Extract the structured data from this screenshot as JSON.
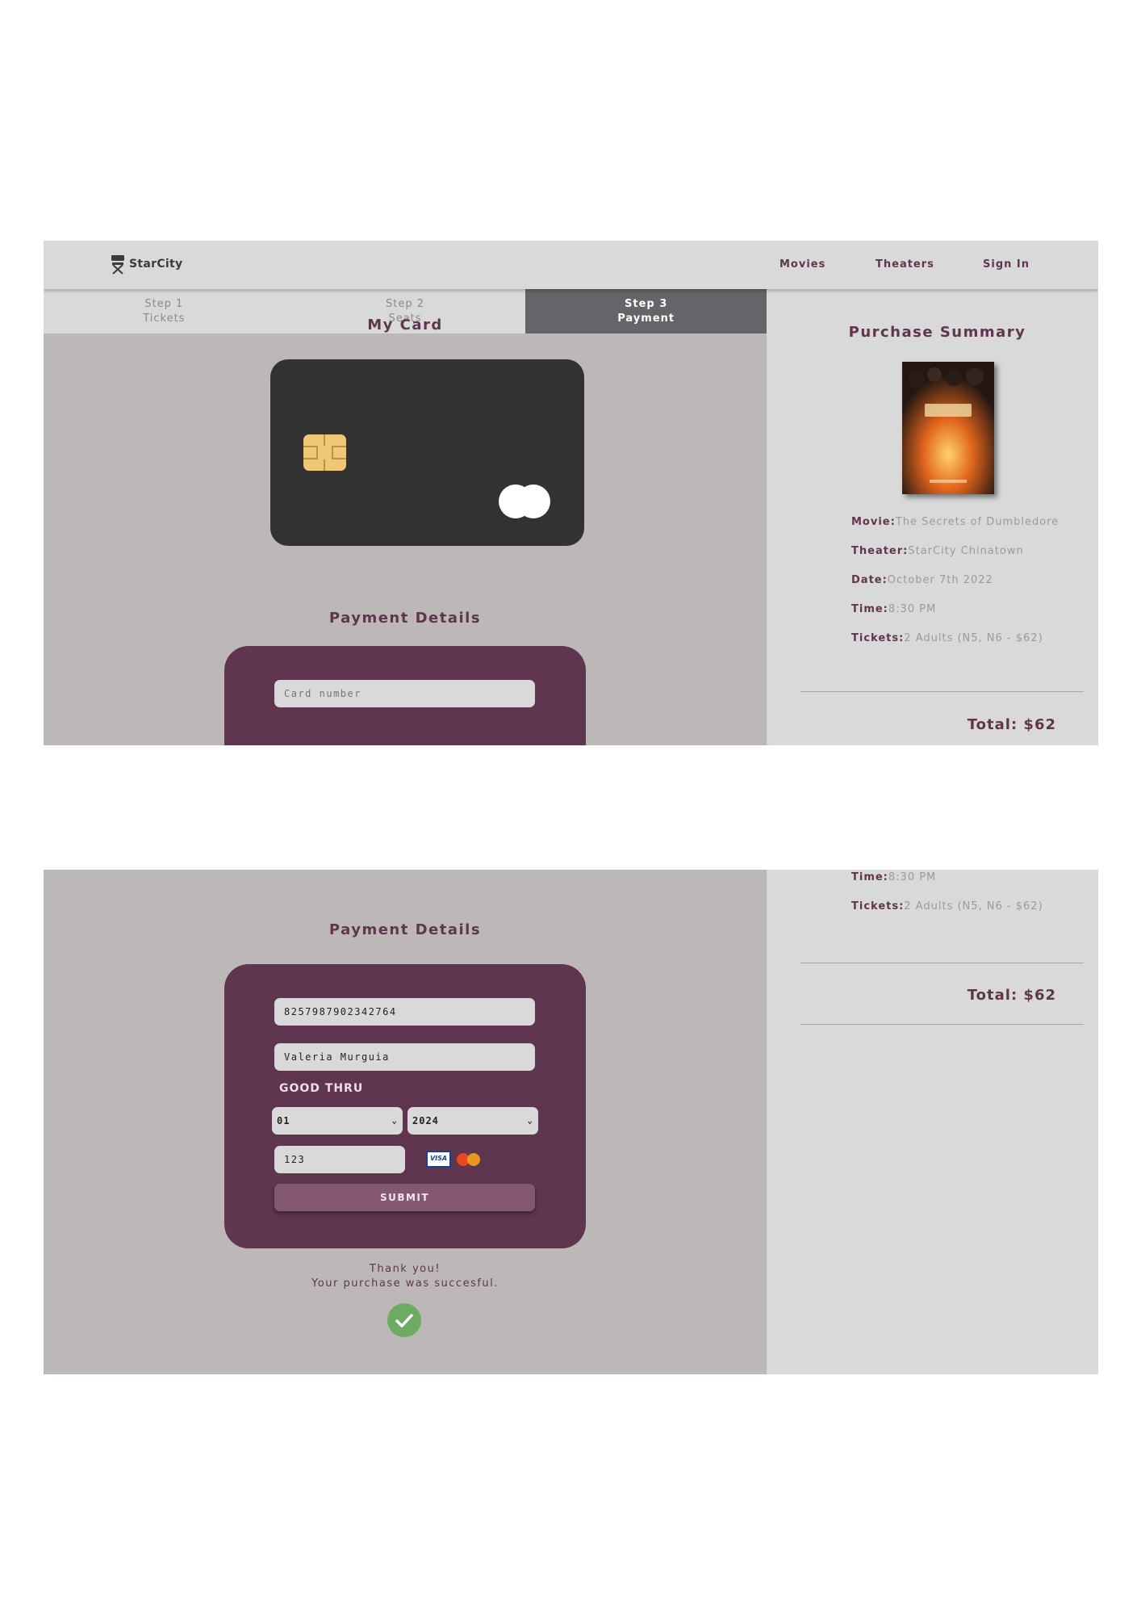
{
  "app": {
    "name": "StarCity"
  },
  "nav": {
    "movies": "Movies",
    "theaters": "Theaters",
    "sign_in": "Sign In"
  },
  "steps": [
    {
      "num": "Step 1",
      "label": "Tickets",
      "active": false
    },
    {
      "num": "Step 2",
      "label": "Seats",
      "active": false
    },
    {
      "num": "Step 3",
      "label": "Payment",
      "active": true
    }
  ],
  "card_section": {
    "title": "My Card"
  },
  "payment": {
    "title": "Payment Details",
    "card_number_placeholder": "Card number",
    "card_number": "8257987902342764",
    "name": "Valeria Murguia",
    "good_thru_label": "GOOD THRU",
    "month": "01",
    "year": "2024",
    "cvv": "123",
    "visa_label": "VISA",
    "submit_label": "SUBMIT"
  },
  "confirmation": {
    "line1": "Thank you!",
    "line2": "Your purchase was succesful."
  },
  "summary": {
    "title": "Purchase Summary",
    "rows": [
      {
        "key": "Movie:",
        "value": "The Secrets of Dumbledore"
      },
      {
        "key": "Theater:",
        "value": "StarCity Chinatown"
      },
      {
        "key": "Date:",
        "value": "October 7th 2022"
      },
      {
        "key": "Time:",
        "value": "8:30 PM"
      },
      {
        "key": "Tickets:",
        "value": "2 Adults (N5, N6 - $62)"
      }
    ],
    "total": "Total: $62"
  },
  "colors": {
    "accent": "#5f3550",
    "main_bg": "#bdb8b8",
    "side_bg": "#d9d9d9",
    "card_bg": "#323232",
    "chip": "#f0c775",
    "success": "#6bab62"
  },
  "icons": [
    "director-chair-icon",
    "card-chip-icon",
    "mastercard-logo-icon",
    "visa-logo-icon",
    "chevron-down-icon",
    "check-icon"
  ]
}
